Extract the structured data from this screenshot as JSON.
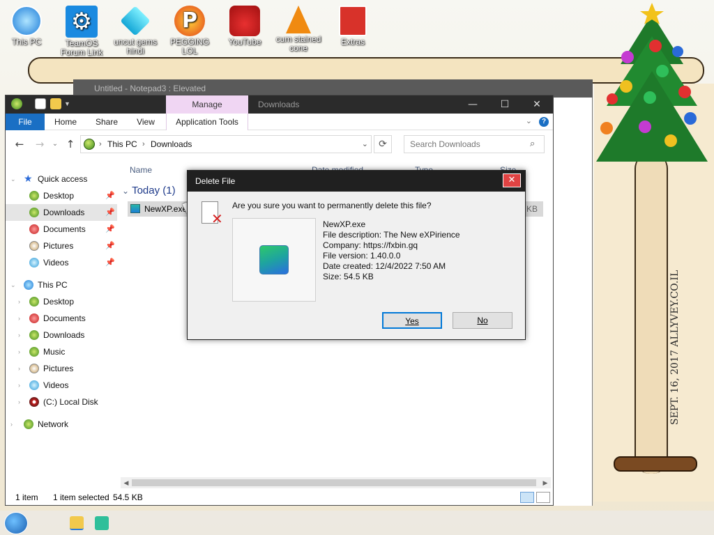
{
  "desktop": {
    "icons": [
      {
        "label": "This PC"
      },
      {
        "label": "TeamOS Forum Link"
      },
      {
        "label": "uncut gems hindi"
      },
      {
        "label": "PEGGING LOL"
      },
      {
        "label": "YouTube"
      },
      {
        "label": "cum stained cone"
      },
      {
        "label": "Extras"
      }
    ],
    "scroll_text": "SEPT. 16, 2017 ALLYVEY.CO.IL"
  },
  "notepad": {
    "title": "Untitled - Notepad3 : Elevated"
  },
  "explorer": {
    "context_tab": "Manage",
    "title": "Downloads",
    "ribbon_tabs": {
      "file": "File",
      "home": "Home",
      "share": "Share",
      "view": "View",
      "app_tools": "Application Tools"
    },
    "breadcrumb": {
      "root": "This PC",
      "current": "Downloads"
    },
    "search_placeholder": "Search Downloads",
    "nav": {
      "quick_access": "Quick access",
      "qa_desktop": "Desktop",
      "qa_downloads": "Downloads",
      "qa_documents": "Documents",
      "qa_pictures": "Pictures",
      "qa_videos": "Videos",
      "this_pc": "This PC",
      "pc_desktop": "Desktop",
      "pc_documents": "Documents",
      "pc_downloads": "Downloads",
      "pc_music": "Music",
      "pc_pictures": "Pictures",
      "pc_videos": "Videos",
      "pc_disk": "(C:) Local Disk",
      "network": "Network"
    },
    "columns": {
      "name": "Name",
      "date": "Date modified",
      "type": "Type",
      "size": "Size"
    },
    "group": "Today (1)",
    "file": {
      "name": "NewXP.exe",
      "size": "5 KB"
    },
    "status": {
      "count": "1 item",
      "selected": "1 item selected",
      "size": "54.5 KB"
    }
  },
  "dialog": {
    "title": "Delete File",
    "question": "Are you sure you want to permanently delete this file?",
    "file_name": "NewXP.exe",
    "description": "File description: The New eXPirience",
    "company": "Company: https://fxbin.gq",
    "version": "File version: 1.40.0.0",
    "created": "Date created: 12/4/2022 7:50 AM",
    "size": "Size: 54.5 KB",
    "yes": "Yes",
    "no": "No"
  }
}
